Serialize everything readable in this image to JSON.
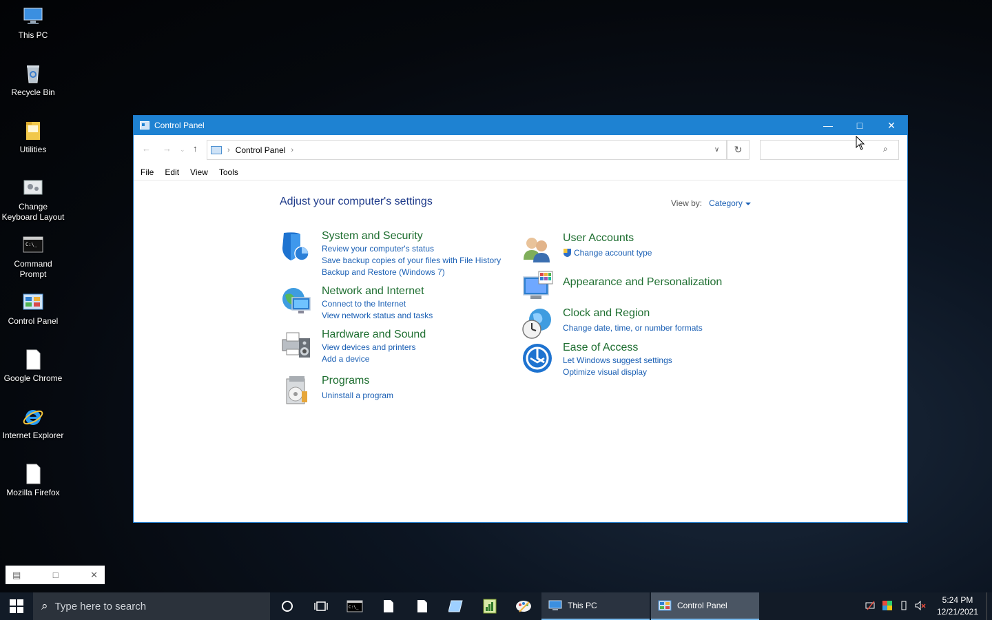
{
  "desktop": {
    "icons": [
      {
        "label": "This PC"
      },
      {
        "label": "Recycle Bin"
      },
      {
        "label": "Utilities"
      },
      {
        "label": "Change Keyboard Layout"
      },
      {
        "label": "Command Prompt"
      },
      {
        "label": "Control Panel"
      },
      {
        "label": "Google Chrome"
      },
      {
        "label": "Internet Explorer"
      },
      {
        "label": "Mozilla Firefox"
      }
    ]
  },
  "window": {
    "title": "Control Panel",
    "address": {
      "crumb": "Control Panel"
    },
    "search": {
      "placeholder": ""
    },
    "menu": [
      "File",
      "Edit",
      "View",
      "Tools"
    ],
    "heading": "Adjust your computer's settings",
    "view_by": {
      "label": "View by:",
      "value": "Category"
    },
    "left_categories": [
      {
        "title": "System and Security",
        "links": [
          "Review your computer's status",
          "Save backup copies of your files with File History",
          "Backup and Restore (Windows 7)"
        ]
      },
      {
        "title": "Network and Internet",
        "links": [
          "Connect to the Internet",
          "View network status and tasks"
        ]
      },
      {
        "title": "Hardware and Sound",
        "links": [
          "View devices and printers",
          "Add a device"
        ]
      },
      {
        "title": "Programs",
        "links": [
          "Uninstall a program"
        ]
      }
    ],
    "right_categories": [
      {
        "title": "User Accounts",
        "links": [
          "Change account type"
        ]
      },
      {
        "title": "Appearance and Personalization",
        "links": []
      },
      {
        "title": "Clock and Region",
        "links": [
          "Change date, time, or number formats"
        ]
      },
      {
        "title": "Ease of Access",
        "links": [
          "Let Windows suggest settings",
          "Optimize visual display"
        ]
      }
    ]
  },
  "taskbar": {
    "search_placeholder": "Type here to search",
    "apps": [
      {
        "label": "This PC"
      },
      {
        "label": "Control Panel"
      }
    ],
    "clock": {
      "time": "5:24 PM",
      "date": "12/21/2021"
    }
  },
  "colors": {
    "titlebar": "#1e82d2",
    "category_title": "#1e6e30",
    "link": "#1a5fb4",
    "taskbar": "#121b27"
  }
}
